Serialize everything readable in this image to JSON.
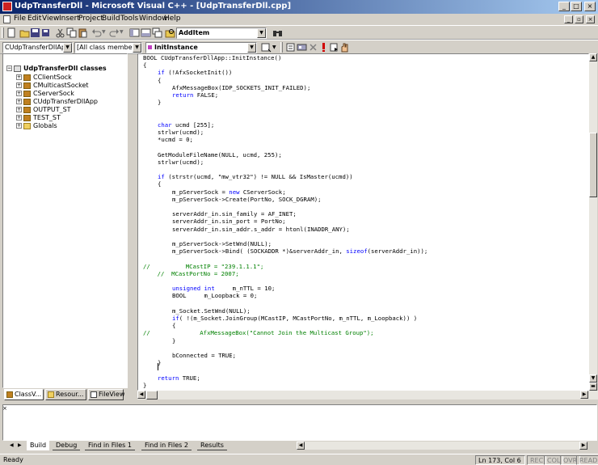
{
  "window": {
    "title": "UdpTransferDll - Microsoft Visual C++ - [UdpTransferDll.cpp]"
  },
  "menu": [
    "File",
    "Edit",
    "View",
    "Insert",
    "Project",
    "Build",
    "Tools",
    "Window",
    "Help"
  ],
  "toolbar": {
    "find_combo_value": "AddItem",
    "class_combo_value": "CUdpTransferDllApp",
    "filter_combo_value": "[All class members]",
    "member_combo_value": "InitInstance"
  },
  "class_view": {
    "root": "UdpTransferDll classes",
    "items": [
      "CClientSock",
      "CMulticastSocket",
      "CServerSock",
      "CUdpTransferDllApp",
      "OUTPUT_ST",
      "TEST_ST",
      "Globals"
    ],
    "tabs": [
      "ClassV...",
      "Resour...",
      "FileView"
    ]
  },
  "code_lines": [
    {
      "indent": 0,
      "text": "BOOL CUdpTransferDllApp::InitInstance()",
      "type": "code"
    },
    {
      "indent": 0,
      "text": "{",
      "type": "code"
    },
    {
      "indent": 1,
      "text": "if (!AfxSocketInit())",
      "type": "kwstart",
      "kw": "if"
    },
    {
      "indent": 1,
      "text": "{",
      "type": "code"
    },
    {
      "indent": 2,
      "text": "AfxMessageBox(IDP_SOCKETS_INIT_FAILED);",
      "type": "code"
    },
    {
      "indent": 2,
      "text": "return FALSE;",
      "type": "kwstart",
      "kw": "return"
    },
    {
      "indent": 1,
      "text": "}",
      "type": "code"
    },
    {
      "indent": 0,
      "text": "",
      "type": "code"
    },
    {
      "indent": 0,
      "text": "",
      "type": "code"
    },
    {
      "indent": 1,
      "text": "char ucmd [255];",
      "type": "kwstart",
      "kw": "char"
    },
    {
      "indent": 1,
      "text": "strlwr(ucmd);",
      "type": "code"
    },
    {
      "indent": 1,
      "text": "*ucmd = 0;",
      "type": "code"
    },
    {
      "indent": 0,
      "text": "",
      "type": "code"
    },
    {
      "indent": 1,
      "text": "GetModuleFileName(NULL, ucmd, 255);",
      "type": "code"
    },
    {
      "indent": 1,
      "text": "strlwr(ucmd);",
      "type": "code"
    },
    {
      "indent": 0,
      "text": "",
      "type": "code"
    },
    {
      "indent": 1,
      "text": "if (strstr(ucmd, \"mw_vtr32\") != NULL && IsMaster(ucmd))",
      "type": "kwstart",
      "kw": "if"
    },
    {
      "indent": 1,
      "text": "{",
      "type": "code"
    },
    {
      "indent": 2,
      "text": "m_pServerSock = new CServerSock;",
      "type": "new"
    },
    {
      "indent": 2,
      "text": "m_pServerSock->Create(PortNo, SOCK_DGRAM);",
      "type": "code"
    },
    {
      "indent": 0,
      "text": "",
      "type": "code"
    },
    {
      "indent": 2,
      "text": "serverAddr_in.sin_family = AF_INET;",
      "type": "code"
    },
    {
      "indent": 2,
      "text": "serverAddr_in.sin_port = PortNo;",
      "type": "code"
    },
    {
      "indent": 2,
      "text": "serverAddr_in.sin_addr.s_addr = htonl(INADDR_ANY);",
      "type": "code"
    },
    {
      "indent": 0,
      "text": "",
      "type": "code"
    },
    {
      "indent": 2,
      "text": "m_pServerSock->SetWnd(NULL);",
      "type": "code"
    },
    {
      "indent": 2,
      "text": "m_pServerSock->Bind( (SOCKADDR *)&serverAddr_in, sizeof(serverAddr_in));",
      "type": "sizeof"
    },
    {
      "indent": 0,
      "text": "",
      "type": "code"
    },
    {
      "indent": 0,
      "text": "//          MCastIP = \"239.1.1.1\";",
      "type": "comment"
    },
    {
      "indent": 0,
      "text": "    //  MCastPortNo = 2007;",
      "type": "comment"
    },
    {
      "indent": 0,
      "text": "",
      "type": "code"
    },
    {
      "indent": 2,
      "text": "unsigned int     m_nTTL = 10;",
      "type": "unsigned"
    },
    {
      "indent": 2,
      "text": "BOOL     m_Loopback = 0;",
      "type": "code"
    },
    {
      "indent": 0,
      "text": "",
      "type": "code"
    },
    {
      "indent": 2,
      "text": "m_Socket.SetWnd(NULL);",
      "type": "code"
    },
    {
      "indent": 2,
      "text": "if( !(m_Socket.JoinGroup(MCastIP, MCastPortNo, m_nTTL, m_Loopback)) )",
      "type": "kwstart",
      "kw": "if"
    },
    {
      "indent": 2,
      "text": "{",
      "type": "code"
    },
    {
      "indent": 0,
      "text": "//              AfxMessageBox(\"Cannot Join the Multicast Group\");",
      "type": "comment"
    },
    {
      "indent": 2,
      "text": "}",
      "type": "code"
    },
    {
      "indent": 0,
      "text": "",
      "type": "code"
    },
    {
      "indent": 2,
      "text": "bConnected = TRUE;",
      "type": "code"
    },
    {
      "indent": 1,
      "text": "}",
      "type": "code"
    },
    {
      "indent": 0,
      "text": "",
      "type": "code"
    },
    {
      "indent": 1,
      "text": "return TRUE;",
      "type": "kwstart",
      "kw": "return"
    },
    {
      "indent": 0,
      "text": "}",
      "type": "code"
    }
  ],
  "output_tabs": [
    "Build",
    "Debug",
    "Find in Files 1",
    "Find in Files 2",
    "Results"
  ],
  "status": {
    "text": "Ready",
    "position": "Ln 173, Col 6",
    "indicators": [
      "REC",
      "COL",
      "OVR",
      "READ"
    ]
  }
}
